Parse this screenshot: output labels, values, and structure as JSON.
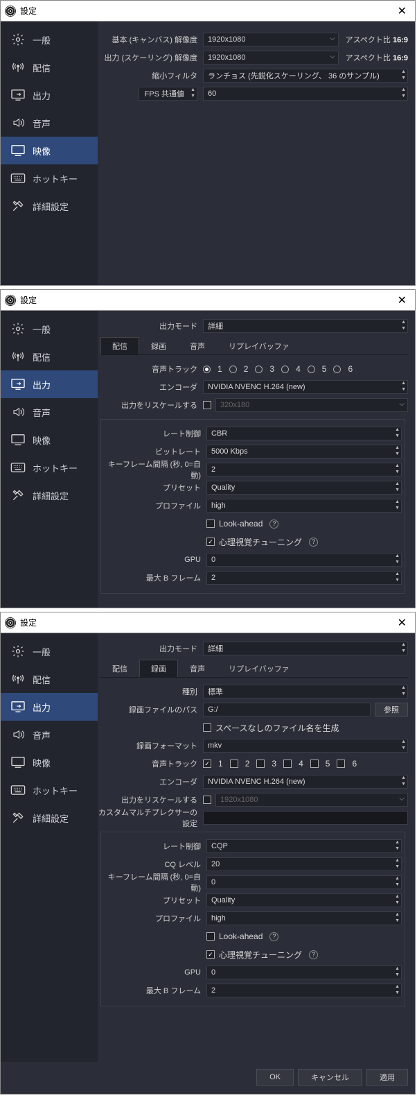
{
  "title": "設定",
  "sidebar": {
    "items": [
      {
        "label": "一般"
      },
      {
        "label": "配信"
      },
      {
        "label": "出力"
      },
      {
        "label": "音声"
      },
      {
        "label": "映像"
      },
      {
        "label": "ホットキー"
      },
      {
        "label": "詳細設定"
      }
    ]
  },
  "video": {
    "base_label": "基本 (キャンバス) 解像度",
    "base_value": "1920x1080",
    "base_aspect_label": "アスペクト比",
    "base_aspect_value": "16:9",
    "scaled_label": "出力 (スケーリング) 解像度",
    "scaled_value": "1920x1080",
    "scaled_aspect_label": "アスペクト比",
    "scaled_aspect_value": "16:9",
    "filter_label": "縮小フィルタ",
    "filter_value": "ランチョス (先鋭化スケーリング、 36 のサンプル)",
    "fps_label": "FPS 共通値",
    "fps_value": "60"
  },
  "output": {
    "mode_label": "出力モード",
    "mode_value": "詳細",
    "tabs": [
      "配信",
      "録画",
      "音声",
      "リプレイバッファ"
    ],
    "stream": {
      "audio_track_label": "音声トラック",
      "tracks": [
        "1",
        "2",
        "3",
        "4",
        "5",
        "6"
      ],
      "encoder_label": "エンコーダ",
      "encoder_value": "NVIDIA NVENC H.264 (new)",
      "rescale_label": "出力をリスケールする",
      "rescale_value": "320x180",
      "rate_control_label": "レート制御",
      "rate_control_value": "CBR",
      "bitrate_label": "ビットレート",
      "bitrate_value": "5000 Kbps",
      "keyframe_label": "キーフレーム間隔 (秒, 0=自動)",
      "keyframe_value": "2",
      "preset_label": "プリセット",
      "preset_value": "Quality",
      "profile_label": "プロファイル",
      "profile_value": "high",
      "lookahead_label": "Look-ahead",
      "psycho_label": "心理視覚チューニング",
      "gpu_label": "GPU",
      "gpu_value": "0",
      "bframes_label": "最大 B フレーム",
      "bframes_value": "2"
    },
    "record": {
      "type_label": "種別",
      "type_value": "標準",
      "path_label": "録画ファイルのパス",
      "path_value": "G:/",
      "browse_label": "参照",
      "nospace_label": "スペースなしのファイル名を生成",
      "format_label": "録画フォーマット",
      "format_value": "mkv",
      "audio_track_label": "音声トラック",
      "tracks": [
        "1",
        "2",
        "3",
        "4",
        "5",
        "6"
      ],
      "encoder_label": "エンコーダ",
      "encoder_value": "NVIDIA NVENC H.264 (new)",
      "rescale_label": "出力をリスケールする",
      "rescale_value": "1920x1080",
      "mux_label": "カスタムマルチプレクサーの設定",
      "rate_control_label": "レート制御",
      "rate_control_value": "CQP",
      "cq_label": "CQ レベル",
      "cq_value": "20",
      "keyframe_label": "キーフレーム間隔 (秒, 0=自動)",
      "keyframe_value": "0",
      "preset_label": "プリセット",
      "preset_value": "Quality",
      "profile_label": "プロファイル",
      "profile_value": "high",
      "lookahead_label": "Look-ahead",
      "psycho_label": "心理視覚チューニング",
      "gpu_label": "GPU",
      "gpu_value": "0",
      "bframes_label": "最大 B フレーム",
      "bframes_value": "2"
    }
  },
  "buttons": {
    "ok": "OK",
    "cancel": "キャンセル",
    "apply": "適用"
  }
}
